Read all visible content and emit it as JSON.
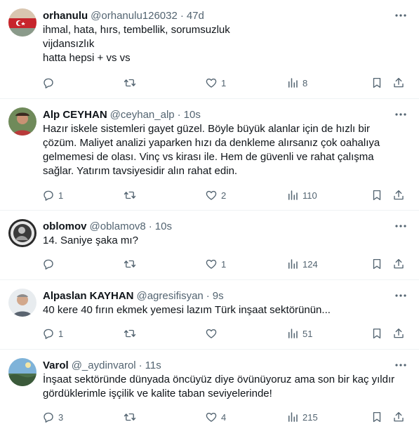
{
  "tweets": [
    {
      "name": "orhanulu",
      "handle": "@orhanulu126032",
      "time": "47d",
      "lines": [
        "ihmal, hata, hırs, tembellik, sorumsuzluk",
        "vijdansızlık",
        "hatta hepsi + vs vs"
      ],
      "replies": "",
      "retweets": "",
      "likes": "1",
      "views": "8"
    },
    {
      "name": "Alp CEYHAN",
      "handle": "@ceyhan_alp",
      "time": "10s",
      "lines": [
        "Hazır iskele sistemleri gayet güzel. Böyle büyük alanlar için de hızlı bir",
        "çözüm. Maliyet analizi yaparken hızı da denkleme alırsanız çok oahalıya",
        "gelmemesi de olası. Vinç vs kirası ile. Hem de güvenli ve rahat çalışma",
        "sağlar. Yatırım tavsiyesidir alın rahat edin."
      ],
      "replies": "1",
      "retweets": "",
      "likes": "2",
      "views": "110"
    },
    {
      "name": "oblomov",
      "handle": "@oblamov8",
      "time": "10s",
      "lines": [
        "14. Saniye şaka mı?"
      ],
      "replies": "",
      "retweets": "",
      "likes": "1",
      "views": "124"
    },
    {
      "name": "Alpaslan KAYHAN",
      "handle": "@agresifisyan",
      "time": "9s",
      "lines": [
        "40 kere 40 fırın ekmek yemesi lazım Türk inşaat sektörünün..."
      ],
      "replies": "1",
      "retweets": "",
      "likes": "",
      "views": "51"
    },
    {
      "name": "Varol",
      "handle": "@_aydinvarol",
      "time": "11s",
      "lines": [
        "İnşaat sektöründe dünyada öncüyüz diye övünüyoruz ama son bir kaç yıldır",
        "gördüklerimle işçilik ve kalite taban seviyelerinde!"
      ],
      "replies": "3",
      "retweets": "",
      "likes": "4",
      "views": "215"
    }
  ],
  "icons": {
    "more": "more-dots-icon",
    "reply": "reply-bubble-icon",
    "retweet": "retweet-icon",
    "like": "heart-icon",
    "views": "views-bars-icon",
    "bookmark": "bookmark-icon",
    "share": "share-icon"
  },
  "colors": {
    "text": "#0f1419",
    "secondary": "#536471",
    "divider": "#eff3f4"
  }
}
